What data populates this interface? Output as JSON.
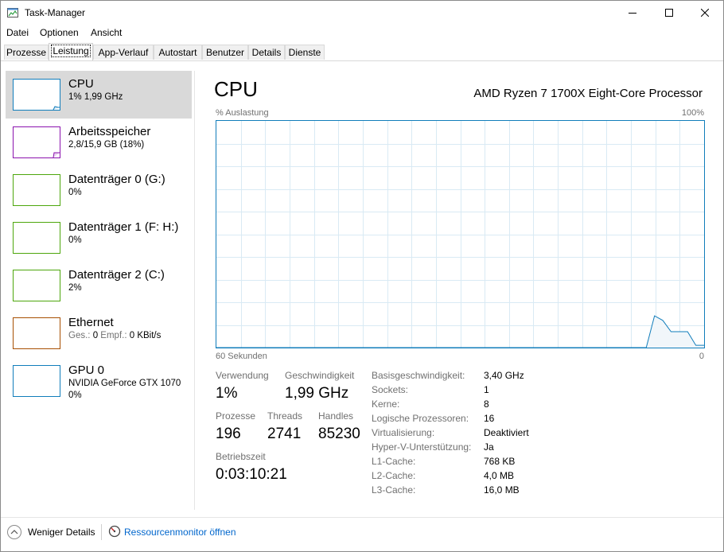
{
  "window": {
    "title": "Task-Manager"
  },
  "menu": [
    {
      "label": "Datei"
    },
    {
      "label": "Optionen"
    },
    {
      "label": "Ansicht"
    }
  ],
  "tabs": [
    {
      "label": "Prozesse"
    },
    {
      "label": "Leistung"
    },
    {
      "label": "App-Verlauf"
    },
    {
      "label": "Autostart"
    },
    {
      "label": "Benutzer"
    },
    {
      "label": "Details"
    },
    {
      "label": "Dienste"
    }
  ],
  "sidebar": {
    "items": [
      {
        "title": "CPU",
        "sub": "1% 1,99 GHz",
        "color": "#117dbb"
      },
      {
        "title": "Arbeitsspeicher",
        "sub": "2,8/15,9 GB (18%)",
        "color": "#8b12ae"
      },
      {
        "title": "Datenträger 0 (G:)",
        "sub": "0%",
        "color": "#4da60c"
      },
      {
        "title": "Datenträger 1 (F: H:)",
        "sub": "0%",
        "color": "#4da60c"
      },
      {
        "title": "Datenträger 2 (C:)",
        "sub": "2%",
        "color": "#4da60c"
      },
      {
        "title": "Ethernet",
        "sub_label_send": "Ges.:",
        "sub_value_send": "0",
        "sub_label_recv": "Empf.:",
        "sub_value_recv": "0 KBit/s",
        "color": "#a74f01"
      },
      {
        "title": "GPU 0",
        "sub": "NVIDIA GeForce GTX 1070",
        "sub2": "0%",
        "color": "#117dbb"
      }
    ]
  },
  "main": {
    "title": "CPU",
    "model": "AMD Ryzen 7 1700X Eight-Core Processor",
    "graph": {
      "ylabel": "% Auslastung",
      "ymax_label": "100%",
      "xlabel": "60 Sekunden",
      "xmin_label": "0",
      "line_color": "#117dbb",
      "usage_history": [
        0,
        0,
        0,
        0,
        0,
        0,
        0,
        0,
        0,
        0,
        0,
        0,
        0,
        0,
        0,
        0,
        0,
        0,
        0,
        0,
        0,
        0,
        0,
        0,
        0,
        0,
        0,
        0,
        0,
        0,
        0,
        0,
        0,
        0,
        0,
        0,
        0,
        0,
        0,
        0,
        0,
        0,
        0,
        0,
        0,
        0,
        0,
        0,
        0,
        0,
        0,
        0,
        0,
        14,
        12,
        7,
        7,
        7,
        1,
        1
      ]
    },
    "stats": {
      "usage_label": "Verwendung",
      "usage_value": "1%",
      "speed_label": "Geschwindigkeit",
      "speed_value": "1,99 GHz",
      "processes_label": "Prozesse",
      "processes_value": "196",
      "threads_label": "Threads",
      "threads_value": "2741",
      "handles_label": "Handles",
      "handles_value": "85230",
      "uptime_label": "Betriebszeit",
      "uptime_value": "0:03:10:21"
    },
    "specs": [
      {
        "label": "Basisgeschwindigkeit:",
        "value": "3,40 GHz"
      },
      {
        "label": "Sockets:",
        "value": "1"
      },
      {
        "label": "Kerne:",
        "value": "8"
      },
      {
        "label": "Logische Prozessoren:",
        "value": "16"
      },
      {
        "label": "Virtualisierung:",
        "value": "Deaktiviert"
      },
      {
        "label": "Hyper-V-Unterstützung:",
        "value": "Ja"
      },
      {
        "label": "L1-Cache:",
        "value": "768 KB"
      },
      {
        "label": "L2-Cache:",
        "value": "4,0 MB"
      },
      {
        "label": "L3-Cache:",
        "value": "16,0 MB"
      }
    ]
  },
  "footer": {
    "fewer_details": "Weniger Details",
    "resource_monitor": "Ressourcenmonitor öffnen"
  }
}
